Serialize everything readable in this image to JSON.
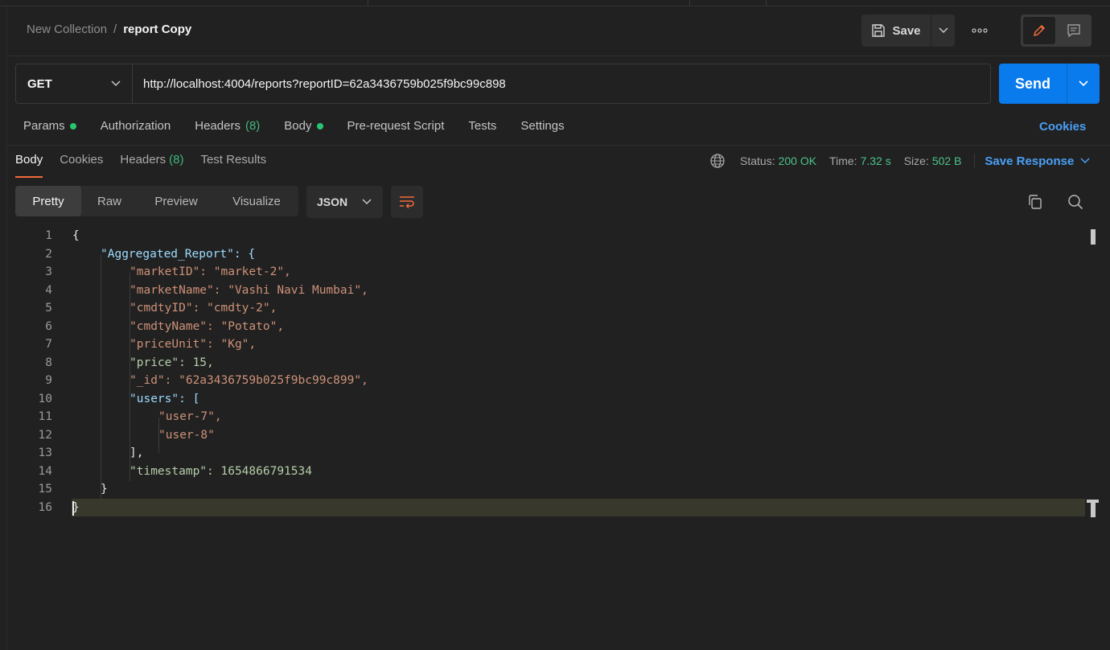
{
  "header": {
    "breadcrumb_parent": "New Collection",
    "breadcrumb_separator": "/",
    "request_name": "report Copy",
    "save_label": "Save",
    "more_icon": "ellipsis-icon",
    "edit_icon": "pencil-icon",
    "comment_icon": "comment-icon"
  },
  "request": {
    "method": "GET",
    "url": "http://localhost:4004/reports?reportID=62a3436759b025f9bc99c898",
    "send_label": "Send"
  },
  "request_tabs": {
    "params": "Params",
    "authorization": "Authorization",
    "headers": "Headers",
    "headers_count": "(8)",
    "body": "Body",
    "pre_request": "Pre-request Script",
    "tests": "Tests",
    "settings": "Settings",
    "cookies": "Cookies"
  },
  "response_tabs": {
    "body": "Body",
    "cookies": "Cookies",
    "headers": "Headers",
    "headers_count": "(8)",
    "test_results": "Test Results"
  },
  "response_meta": {
    "status_label": "Status:",
    "status_value": "200 OK",
    "time_label": "Time:",
    "time_value": "7.32 s",
    "size_label": "Size:",
    "size_value": "502 B",
    "save_response": "Save Response"
  },
  "view": {
    "options": [
      "Pretty",
      "Raw",
      "Preview",
      "Visualize"
    ],
    "active": "Pretty",
    "format": "JSON"
  },
  "colors": {
    "accent": "#097bed",
    "active_tab_underline": "#f26b3a",
    "status_green": "#4cc38a",
    "link_blue": "#4a9ff5"
  },
  "code_lines": [
    {
      "n": "1",
      "text": "{"
    },
    {
      "n": "2",
      "text": "\"Aggregated_Report\": {"
    },
    {
      "n": "3",
      "text": "\"marketID\": \"market-2\","
    },
    {
      "n": "4",
      "text": "\"marketName\": \"Vashi Navi Mumbai\","
    },
    {
      "n": "5",
      "text": "\"cmdtyID\": \"cmdty-2\","
    },
    {
      "n": "6",
      "text": "\"cmdtyName\": \"Potato\","
    },
    {
      "n": "7",
      "text": "\"priceUnit\": \"Kg\","
    },
    {
      "n": "8",
      "text": "\"price\": 15,"
    },
    {
      "n": "9",
      "text": "\"_id\": \"62a3436759b025f9bc99c899\","
    },
    {
      "n": "10",
      "text": "\"users\": ["
    },
    {
      "n": "11",
      "text": "\"user-7\","
    },
    {
      "n": "12",
      "text": "\"user-8\""
    },
    {
      "n": "13",
      "text": "],"
    },
    {
      "n": "14",
      "text": "\"timestamp\": 1654866791534"
    },
    {
      "n": "15",
      "text": "}"
    },
    {
      "n": "16",
      "text": "}"
    }
  ]
}
